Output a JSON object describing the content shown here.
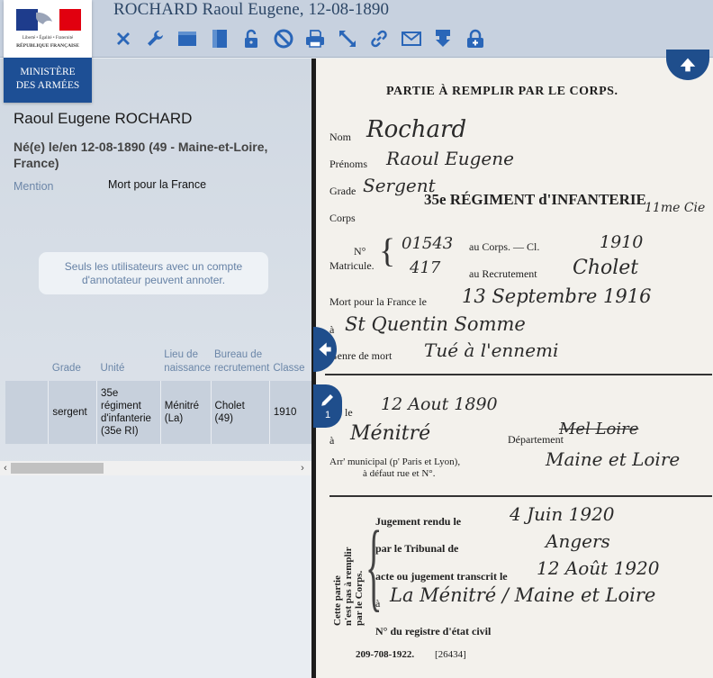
{
  "header": {
    "title": "ROCHARD Raoul Eugene, 12-08-1890",
    "toolbar": [
      {
        "name": "close-icon"
      },
      {
        "name": "wrench-icon"
      },
      {
        "name": "layout-horizontal-icon"
      },
      {
        "name": "layout-vertical-icon"
      },
      {
        "name": "lock-icon"
      },
      {
        "name": "forbidden-icon"
      },
      {
        "name": "print-icon"
      },
      {
        "name": "fullscreen-icon"
      },
      {
        "name": "link-icon"
      },
      {
        "name": "mail-icon"
      },
      {
        "name": "download-icon"
      },
      {
        "name": "lock-plus-icon"
      }
    ]
  },
  "logo": {
    "devise": "Liberté • Égalité • Fraternité",
    "republique": "RÉPUBLIQUE FRANÇAISE",
    "ministere_line1": "MINISTÈRE",
    "ministere_line2": "DES ARMÉES"
  },
  "person": {
    "name": "Raoul Eugene ROCHARD",
    "birth": "Né(e) le/en 12-08-1890 (49 - Maine-et-Loire, France)",
    "mention_label": "Mention",
    "mention_value": "Mort pour la France"
  },
  "annotation_note": "Seuls les utilisateurs avec un compte d'annotateur peuvent annoter.",
  "table": {
    "headers": [
      "",
      "Grade",
      "Unité",
      "Lieu de naissance",
      "Bureau de recrutement",
      "Classe"
    ],
    "row": [
      "",
      "sergent",
      "35e régiment d'infanterie (35e RI)",
      "Ménitré (La)",
      "Cholet (49)",
      "1910"
    ]
  },
  "scrollbar": {
    "left_arrow": "‹",
    "right_arrow": "›"
  },
  "viewer": {
    "annotation_count": "1"
  },
  "document": {
    "heading": "PARTIE À REMPLIR PAR LE CORPS.",
    "nom_label": "Nom",
    "nom_value": "Rochard",
    "prenoms_label": "Prénoms",
    "prenoms_value": "Raoul Eugene",
    "grade_label": "Grade",
    "grade_value": "Sergent",
    "corps_label": "Corps",
    "corps_stamp": "35e RÉGIMENT d'INFANTERIE",
    "compagnie": "11me Cie",
    "no_label": "N°",
    "matricule_label": "Matricule.",
    "au_corps_label": "au Corps. — Cl.",
    "corps_number": "01543",
    "classe_value": "1910",
    "recrutement_number": "417",
    "au_recrutement_label": "au Recrutement",
    "recrutement_value": "Cholet",
    "mort_label": "Mort pour la France le",
    "mort_date": "13 Septembre 1916",
    "a_label": "à",
    "mort_lieu": "St Quentin Somme",
    "genre_label": "Genre de mort",
    "genre_value": "Tué à l'ennemi",
    "ne_label": "Né le",
    "ne_date": "12 Aout 1890",
    "ne_lieu": "Ménitré",
    "departement_label": "Département",
    "departement_value_struck": "Mel Loire",
    "departement_value": "Maine et Loire",
    "arrondissement_label": "Arr' municipal (p' Paris et Lyon),",
    "arrondissement_label2": "à défaut rue et N°.",
    "side_note_line1": "Cette partie",
    "side_note_line2": "n'est pas à remplir",
    "side_note_line3": "par le Corps.",
    "jugement_label": "Jugement rendu le",
    "jugement_date": "4 Juin 1920",
    "tribunal_label": "par le Tribunal de",
    "tribunal_value": "Angers",
    "transcrit_label": "acte ou jugement transcrit le",
    "transcrit_date": "12 Août 1920",
    "transcrit_lieu": "La Ménitré / Maine et Loire",
    "registre_label": "N° du registre d'état civil",
    "footer": "209-708-1922.",
    "footer_code": "[26434]"
  }
}
